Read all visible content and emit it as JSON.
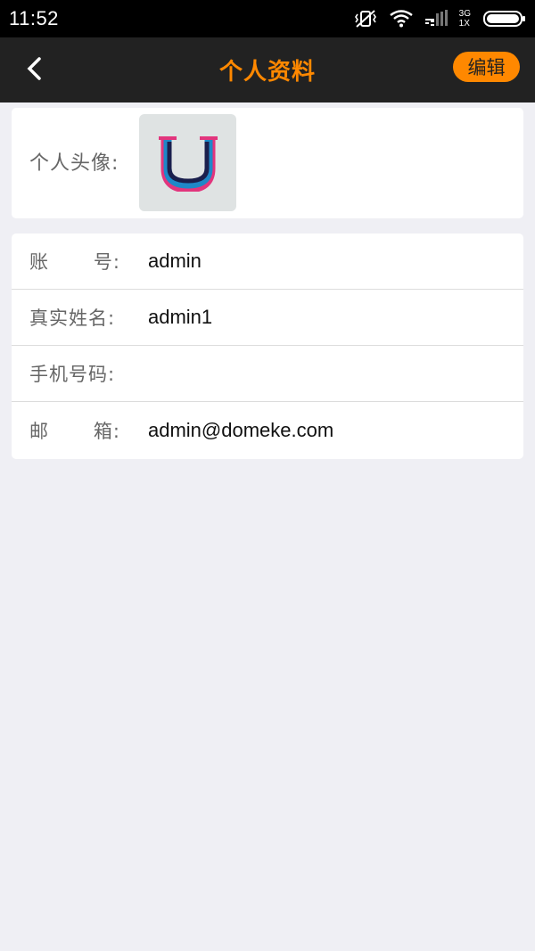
{
  "status_bar": {
    "time": "11:52",
    "network_top": "3G",
    "network_bottom": "1X",
    "icons": [
      "vibrate-icon",
      "wifi-icon",
      "signal-icon",
      "battery-icon"
    ]
  },
  "header": {
    "title": "个人资料",
    "edit_label": "编辑",
    "back_icon": "chevron-left-icon",
    "accent_color": "#ff8800"
  },
  "avatar_section": {
    "label": "个人头像:"
  },
  "info_rows": [
    {
      "label_left": "账",
      "label_right": "号:",
      "value": "admin"
    },
    {
      "label_left": "真实姓名:",
      "label_right": "",
      "value": "admin1"
    },
    {
      "label_left": "手机号码:",
      "label_right": "",
      "value": ""
    },
    {
      "label_left": "邮",
      "label_right": "箱:",
      "value": "admin@domeke.com"
    }
  ]
}
